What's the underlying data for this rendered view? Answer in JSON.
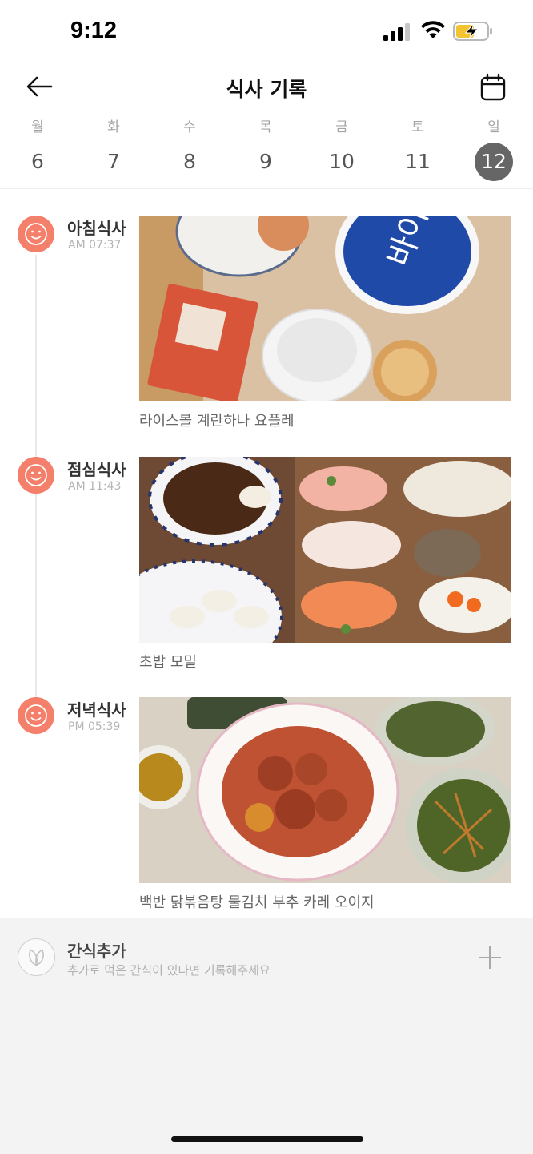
{
  "status_bar": {
    "time": "9:12"
  },
  "header": {
    "title": "식사 기록"
  },
  "week": {
    "days": [
      {
        "name": "월",
        "date": "6"
      },
      {
        "name": "화",
        "date": "7"
      },
      {
        "name": "수",
        "date": "8"
      },
      {
        "name": "목",
        "date": "9"
      },
      {
        "name": "금",
        "date": "10"
      },
      {
        "name": "토",
        "date": "11"
      },
      {
        "name": "일",
        "date": "12"
      }
    ],
    "selected_date": "12"
  },
  "meals": [
    {
      "title": "아침식사",
      "time": "AM 07:37",
      "caption": "라이스볼 계란하나 요플레"
    },
    {
      "title": "점심식사",
      "time": "AM 11:43",
      "caption": "초밥 모밀"
    },
    {
      "title": "저녁식사",
      "time": "PM 05:39",
      "caption": "백반 닭볶음탕 물김치 부추 카레 오이지"
    }
  ],
  "snack": {
    "title": "간식추가",
    "description": "추가로 먹은 간식이 있다면 기록해주세요"
  },
  "colors": {
    "accent": "#f47f6a",
    "selected_day": "#666666"
  }
}
